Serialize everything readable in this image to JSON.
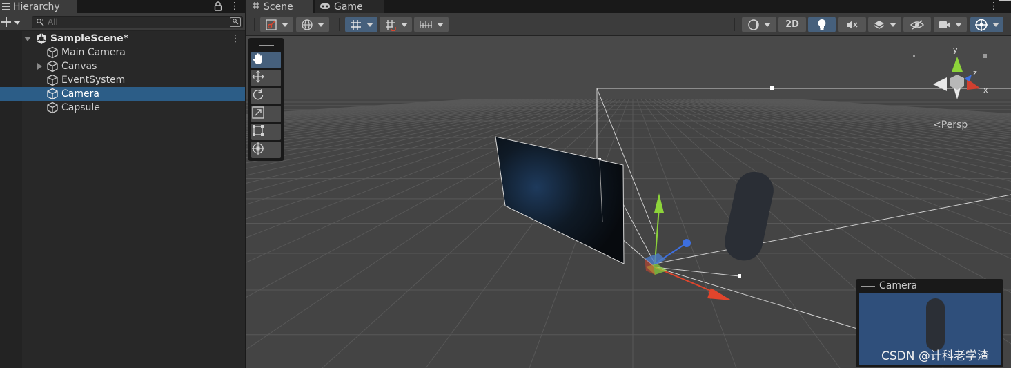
{
  "hierarchy": {
    "tab_title": "Hierarchy",
    "search_placeholder": "All",
    "scene_name": "SampleScene*",
    "items": [
      {
        "label": "Main Camera",
        "selected": false,
        "has_children": false
      },
      {
        "label": "Canvas",
        "selected": false,
        "has_children": true
      },
      {
        "label": "EventSystem",
        "selected": false,
        "has_children": false
      },
      {
        "label": "Camera",
        "selected": true,
        "has_children": false
      },
      {
        "label": "Capsule",
        "selected": false,
        "has_children": false
      }
    ]
  },
  "scene_tabs": [
    {
      "label": "Scene",
      "active": true,
      "icon": "hash-icon"
    },
    {
      "label": "Game",
      "active": false,
      "icon": "gamepad-icon"
    }
  ],
  "scene_toolbar": {
    "mode_2d_label": "2D"
  },
  "viewport": {
    "projection_label": "Persp",
    "gizmo_axes": {
      "x": "x",
      "y": "y",
      "z": "z"
    },
    "camera_preview_title": "Camera",
    "watermark": "CSDN @计科老学渣"
  },
  "colors": {
    "selection": "#2c5d87",
    "axis_x": "#e0452c",
    "axis_y": "#8dd43a",
    "axis_z": "#3d6fe0",
    "preview_background": "#2f4f7b",
    "accent_button": "#46607c"
  }
}
